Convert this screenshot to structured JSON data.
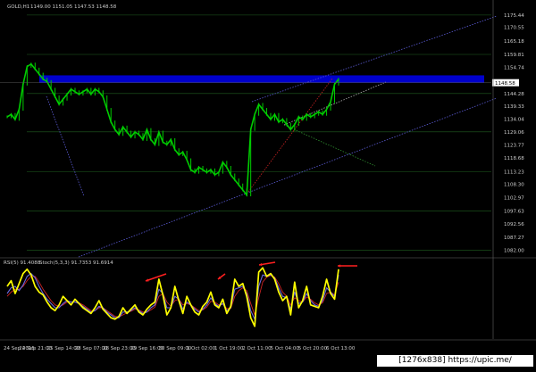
{
  "header": {
    "symbol": "GOLD,H1",
    "ohlc": "1149.00 1151.05 1147.53 1148.58"
  },
  "indicator_header": {
    "label": "RSI(5) 91.4088",
    "stoch": "Stoch(5,3,3) 91.7353 91.6914"
  },
  "watermark": "[1276x838] https://upic.me/",
  "colors": {
    "background": "#000000",
    "candle_up": "#00cc00",
    "grid": "#0d3a0d",
    "resistance_band": "#0000cc",
    "trend_lines": "#5b5bd6",
    "fib_lines": "#1f5e1f",
    "rsi_line": "#ffff00",
    "stoch_main": "#6a6adf",
    "stoch_signal": "#cc2222",
    "arrow": "#ff2020",
    "axis_text": "#cccccc"
  },
  "chart_data": [
    {
      "type": "line",
      "name": "GOLD H1 price",
      "ylim": [
        1079.4,
        1180.0
      ],
      "price_axis_ticks": [
        1175.44,
        1170.55,
        1165.18,
        1159.81,
        1154.74,
        1149.31,
        1144.28,
        1139.33,
        1134.04,
        1129.06,
        1123.77,
        1118.68,
        1113.23,
        1108.3,
        1102.97,
        1097.63,
        1092.56,
        1087.27,
        1082.0
      ],
      "current_price": 1148.58,
      "x_labels": [
        "24 Sep 2015",
        "24 Sep 21:00",
        "25 Sep 14:00",
        "28 Sep 07:00",
        "28 Sep 23:00",
        "29 Sep 16:00",
        "30 Sep 09:00",
        "1 Oct 02:00",
        "1 Oct 19:00",
        "2 Oct 11:00",
        "5 Oct 04:00",
        "5 Oct 20:00",
        "6 Oct 13:00"
      ],
      "close": [
        1135,
        1136,
        1134,
        1138,
        1148,
        1155,
        1156,
        1154,
        1152,
        1150,
        1149,
        1146,
        1143,
        1140,
        1142,
        1144,
        1146,
        1145,
        1144,
        1145,
        1146,
        1144,
        1146,
        1145,
        1143,
        1138,
        1133,
        1130,
        1128,
        1131,
        1129,
        1127,
        1129,
        1128,
        1126,
        1130,
        1126,
        1124,
        1129,
        1125,
        1124,
        1126,
        1122,
        1120,
        1121,
        1118,
        1114,
        1113,
        1115,
        1114,
        1113,
        1114,
        1112,
        1113,
        1117,
        1115,
        1112,
        1110,
        1108,
        1106,
        1104,
        1130,
        1136,
        1140,
        1138,
        1136,
        1134,
        1136,
        1133,
        1134,
        1132,
        1130,
        1132,
        1135,
        1134,
        1136,
        1135,
        1136,
        1137,
        1136,
        1138,
        1141,
        1148,
        1150
      ],
      "rsi": [
        70,
        78,
        60,
        74,
        88,
        94,
        86,
        70,
        62,
        58,
        48,
        40,
        36,
        44,
        56,
        50,
        44,
        52,
        46,
        40,
        36,
        32,
        40,
        50,
        38,
        32,
        26,
        24,
        28,
        40,
        32,
        38,
        44,
        34,
        30,
        38,
        44,
        48,
        80,
        58,
        30,
        40,
        70,
        50,
        32,
        56,
        44,
        34,
        30,
        42,
        48,
        62,
        44,
        40,
        52,
        32,
        42,
        80,
        70,
        74,
        56,
        26,
        14,
        90,
        96,
        84,
        88,
        80,
        62,
        50,
        56,
        30,
        76,
        40,
        50,
        70,
        44,
        42,
        40,
        56,
        80,
        60,
        52,
        94
      ],
      "stoch": [
        60,
        68,
        70,
        64,
        72,
        84,
        88,
        82,
        70,
        60,
        52,
        46,
        40,
        40,
        46,
        50,
        48,
        48,
        46,
        42,
        38,
        34,
        36,
        42,
        40,
        34,
        30,
        26,
        26,
        34,
        34,
        36,
        40,
        36,
        32,
        34,
        40,
        44,
        66,
        60,
        40,
        40,
        56,
        52,
        38,
        48,
        44,
        38,
        34,
        38,
        44,
        54,
        46,
        42,
        46,
        36,
        40,
        66,
        68,
        70,
        60,
        36,
        24,
        70,
        86,
        84,
        86,
        82,
        68,
        56,
        54,
        38,
        62,
        46,
        48,
        60,
        50,
        44,
        42,
        50,
        68,
        62,
        56,
        86
      ],
      "signal": [
        56,
        62,
        66,
        66,
        70,
        78,
        84,
        84,
        76,
        66,
        58,
        50,
        44,
        42,
        44,
        48,
        48,
        48,
        47,
        44,
        40,
        36,
        36,
        40,
        40,
        36,
        32,
        28,
        27,
        30,
        33,
        35,
        38,
        37,
        34,
        34,
        37,
        41,
        56,
        60,
        48,
        42,
        50,
        52,
        44,
        46,
        44,
        40,
        36,
        37,
        41,
        49,
        48,
        44,
        45,
        39,
        39,
        56,
        64,
        68,
        64,
        46,
        30,
        54,
        76,
        83,
        85,
        83,
        74,
        62,
        56,
        44,
        54,
        50,
        48,
        55,
        52,
        47,
        44,
        47,
        60,
        62,
        58,
        76
      ]
    }
  ]
}
